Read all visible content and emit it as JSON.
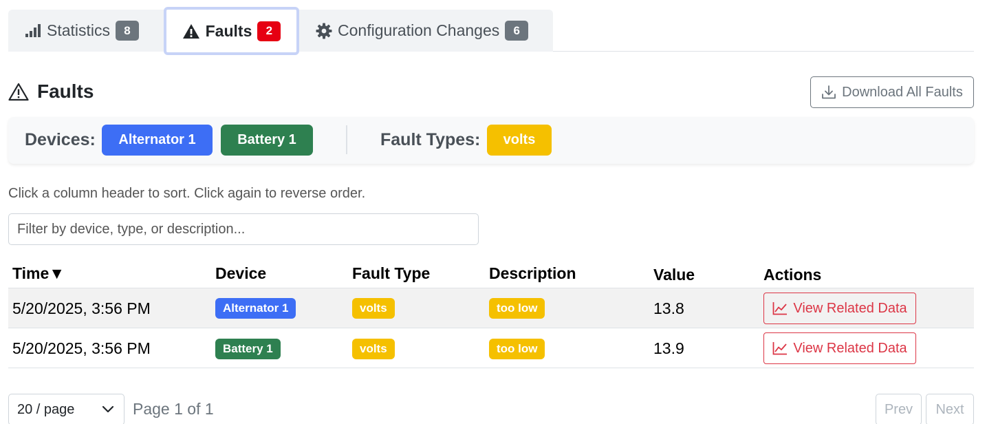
{
  "tabs": [
    {
      "label": "Statistics",
      "count": "8",
      "icon": "bar-chart-icon"
    },
    {
      "label": "Faults",
      "count": "2",
      "icon": "warning-icon"
    },
    {
      "label": "Configuration Changes",
      "count": "6",
      "icon": "gear-icon"
    }
  ],
  "section": {
    "title": "Faults",
    "download_label": "Download All Faults"
  },
  "filters": {
    "devices_label": "Devices:",
    "devices": [
      "Alternator 1",
      "Battery 1"
    ],
    "fault_types_label": "Fault Types:",
    "fault_types": [
      "volts"
    ]
  },
  "hint": "Click a column header to sort. Click again to reverse order.",
  "search": {
    "placeholder": "Filter by device, type, or description...",
    "value": ""
  },
  "table": {
    "headers": [
      "Time▼",
      "Device",
      "Fault Type",
      "Description",
      "Value",
      "Actions"
    ],
    "rows": [
      {
        "time": "5/20/2025, 3:56 PM",
        "device": "Alternator 1",
        "fault_type": "volts",
        "description": "too low",
        "value": "13.8",
        "action": "View Related Data"
      },
      {
        "time": "5/20/2025, 3:56 PM",
        "device": "Battery 1",
        "fault_type": "volts",
        "description": "too low",
        "value": "13.9",
        "action": "View Related Data"
      }
    ]
  },
  "pagination": {
    "page_size": "20 / page",
    "page_info": "Page 1 of 1",
    "prev": "Prev",
    "next": "Next"
  },
  "colors": {
    "primary_blue": "#3d6ef5",
    "success_green": "#2e8050",
    "warning_yellow": "#f5c000",
    "danger_red": "#dc3545",
    "badge_red": "#e60012",
    "badge_gray": "#6c757d"
  }
}
